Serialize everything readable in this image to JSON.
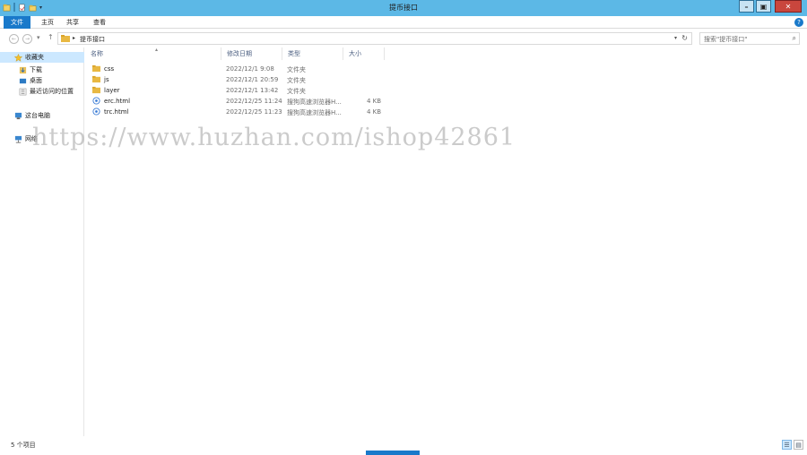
{
  "window": {
    "title": "提币接口"
  },
  "ribbon": {
    "tabs": [
      "文件",
      "主页",
      "共享",
      "查看"
    ],
    "help": "?"
  },
  "address": {
    "path": "提币接口"
  },
  "search": {
    "placeholder": "搜索\"提币接口\""
  },
  "nav": {
    "favorites": "收藏夹",
    "items": [
      "下载",
      "桌面",
      "最近访问的位置"
    ],
    "this_pc": "这台电脑",
    "network": "网络"
  },
  "columns": [
    "名称",
    "修改日期",
    "类型",
    "大小"
  ],
  "files": [
    {
      "name": "css",
      "date": "2022/12/1 9:08",
      "type": "文件夹",
      "size": "",
      "icon": "folder-icon"
    },
    {
      "name": "js",
      "date": "2022/12/1 20:59",
      "type": "文件夹",
      "size": "",
      "icon": "folder-icon"
    },
    {
      "name": "layer",
      "date": "2022/12/1 13:42",
      "type": "文件夹",
      "size": "",
      "icon": "folder-icon"
    },
    {
      "name": "erc.html",
      "date": "2022/12/25 11:24",
      "type": "搜狗高速浏览器H...",
      "size": "4 KB",
      "icon": "html-file-icon"
    },
    {
      "name": "trc.html",
      "date": "2022/12/25 11:23",
      "type": "搜狗高速浏览器H...",
      "size": "4 KB",
      "icon": "html-file-icon"
    }
  ],
  "status": {
    "count": "5 个项目"
  },
  "watermark": "https://www.huzhan.com/ishop42861",
  "colors": {
    "titlebar": "#5cb8e6",
    "accent": "#1979ca",
    "folder": "#e8b842",
    "close": "#c9463d"
  }
}
